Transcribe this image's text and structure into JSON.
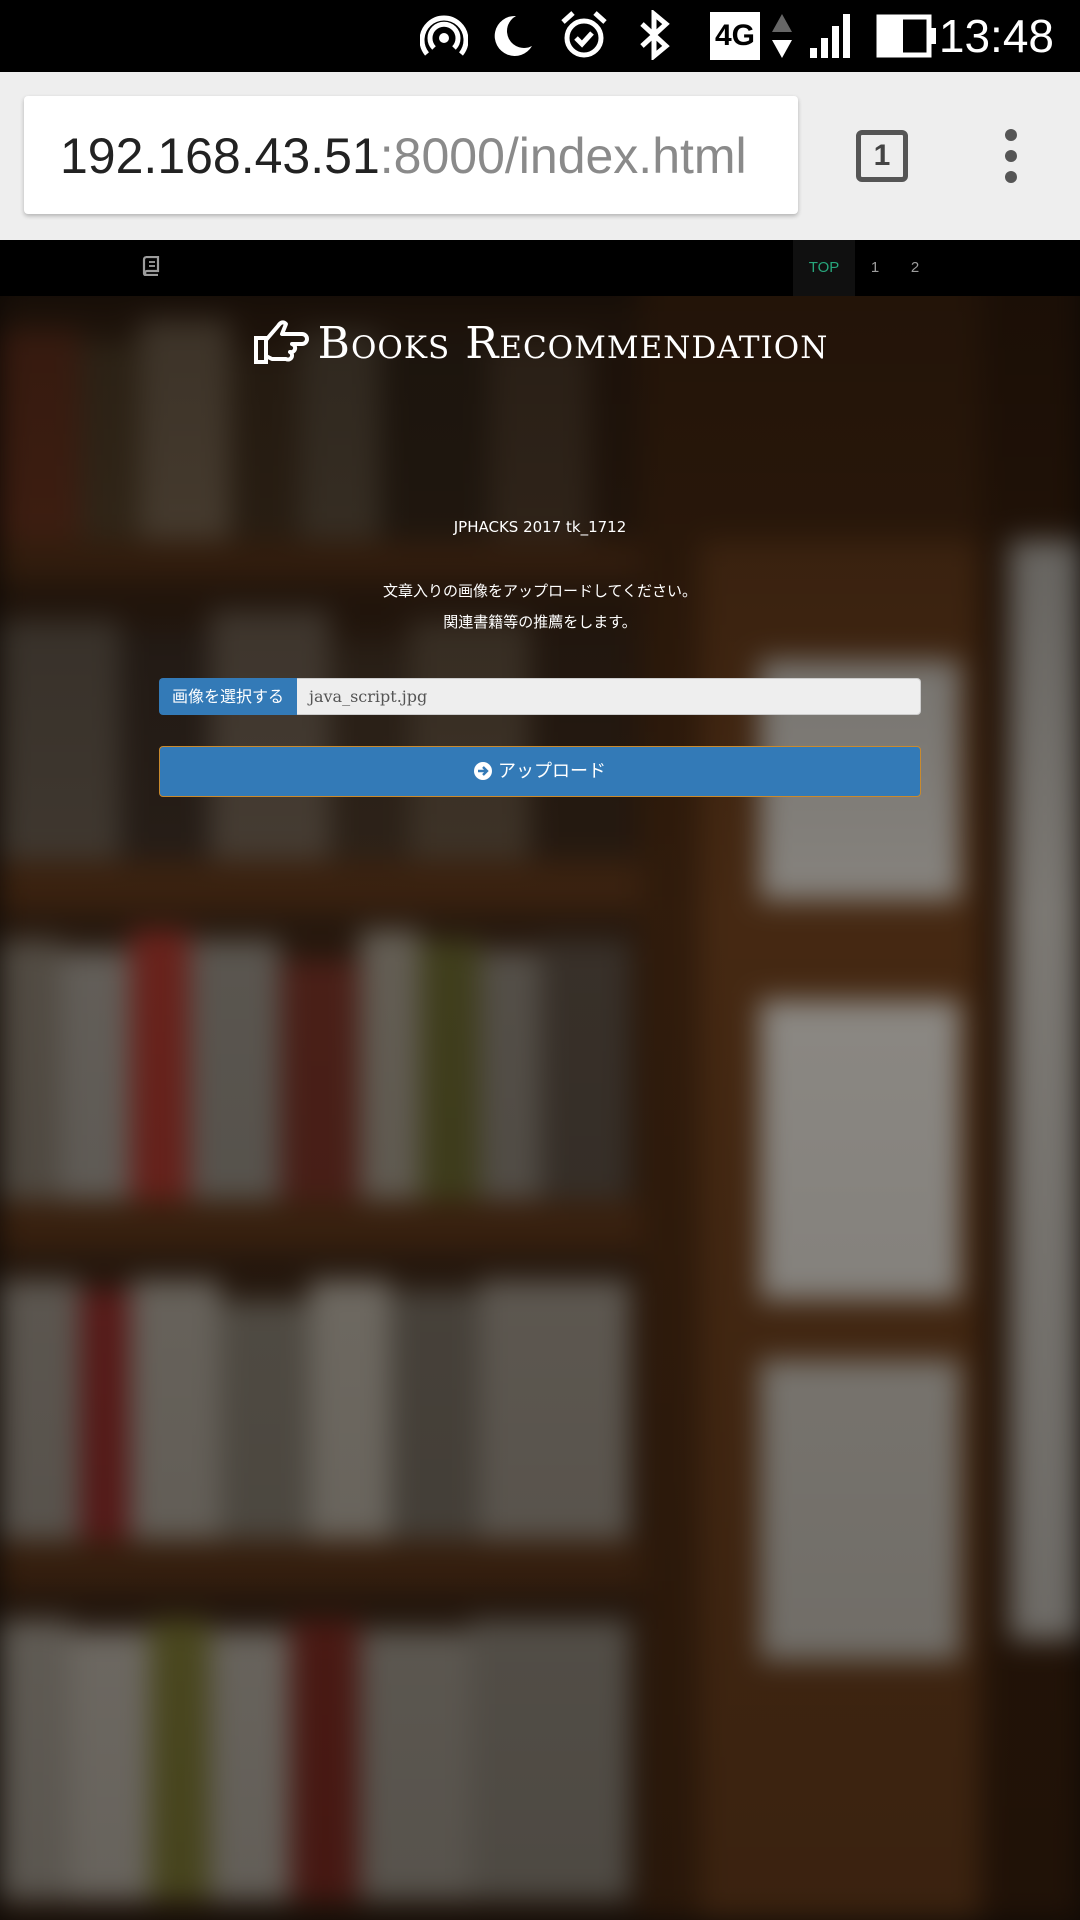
{
  "status_bar": {
    "time": "13:48",
    "network_label": "4G",
    "icons": [
      "hotspot-icon",
      "moon-icon",
      "alarm-icon",
      "bluetooth-icon",
      "network-4g-icon",
      "signal-icon",
      "battery-icon"
    ]
  },
  "browser": {
    "url_host": "192.168.43.51",
    "url_path": ":8000/index.html",
    "tab_count": "1",
    "menu_icon": "overflow-menu-icon"
  },
  "site_nav": {
    "brand_icon": "book-icon",
    "items": [
      {
        "label": "TOP",
        "active": true
      },
      {
        "label": "1",
        "active": false
      },
      {
        "label": "2",
        "active": false
      }
    ]
  },
  "hero": {
    "title": "Books Recommendation",
    "title_icon": "thumbs-right-icon",
    "subtitle": "JPHACKS 2017 tk_1712",
    "desc_line1": "文章入りの画像をアップロードしてください。",
    "desc_line2": "関連書籍等の推薦をします。"
  },
  "upload_form": {
    "select_label": "画像を選択する",
    "file_name": "java_script.jpg",
    "upload_label": "アップロード",
    "upload_icon": "arrow-circle-right-icon"
  },
  "colors": {
    "primary": "#337ab7",
    "nav_active": "#27a57b",
    "nav_bg": "#000000"
  }
}
